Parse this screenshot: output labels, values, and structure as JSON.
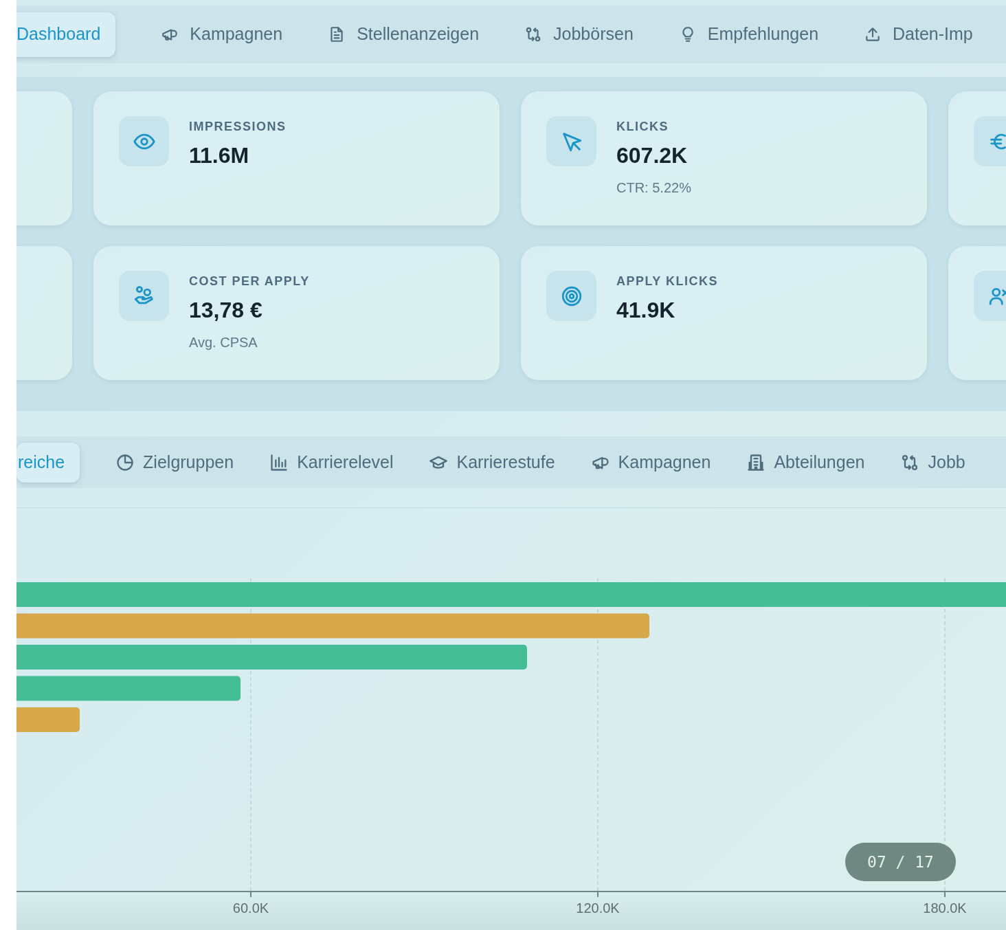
{
  "main_tabs": [
    {
      "label": "Dashboard",
      "selected": true
    },
    {
      "label": "Kampagnen",
      "selected": false
    },
    {
      "label": "Stellenanzeigen",
      "selected": false
    },
    {
      "label": "Jobbörsen",
      "selected": false
    },
    {
      "label": "Empfehlungen",
      "selected": false
    },
    {
      "label": "Daten-Imp",
      "selected": false
    }
  ],
  "kpi_cards": [
    {
      "label": "IMPRESSIONS",
      "value": "11.6M"
    },
    {
      "label": "KLICKS",
      "value": "607.2K",
      "note": "CTR: 5.22%"
    },
    {
      "label": "COST PER APPLY",
      "value": "13,78 €",
      "note": "Avg. CPSA"
    },
    {
      "label": "APPLY KLICKS",
      "value": "41.9K"
    }
  ],
  "chart_tabs": [
    {
      "label": "reiche",
      "selected": true
    },
    {
      "label": "Zielgruppen",
      "selected": false
    },
    {
      "label": "Karrierelevel",
      "selected": false
    },
    {
      "label": "Karrierestufe",
      "selected": false
    },
    {
      "label": "Kampagnen",
      "selected": false
    },
    {
      "label": "Abteilungen",
      "selected": false
    },
    {
      "label": "Jobb",
      "selected": false
    }
  ],
  "chart": {
    "tick_labels": [
      "60.0K",
      "120.0K",
      "180.0K"
    ],
    "bars": [
      {
        "color": "#45bd94"
      },
      {
        "color": "#d6a84a"
      },
      {
        "color": "#45bd94"
      },
      {
        "color": "#45bd94"
      },
      {
        "color": "#d6a84a"
      }
    ]
  },
  "page_counter": "07 / 17"
}
